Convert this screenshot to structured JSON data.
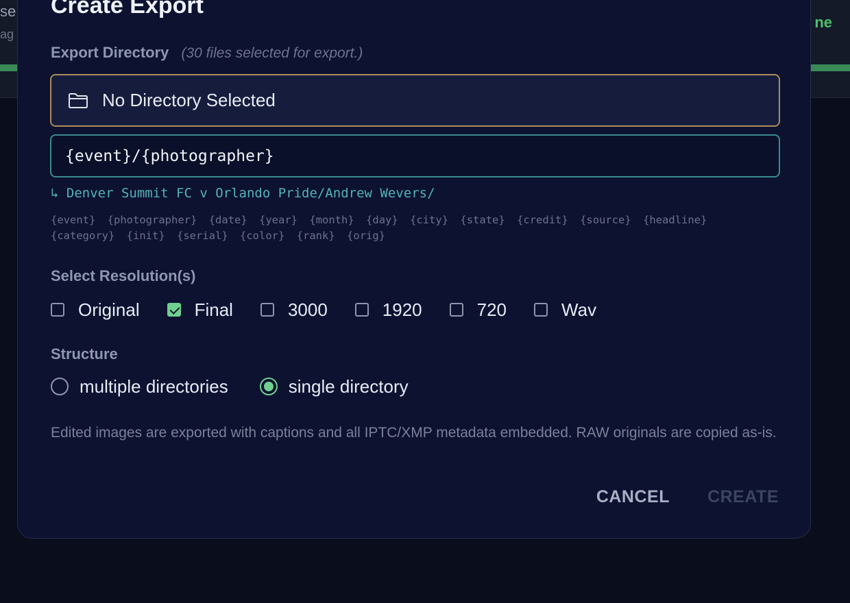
{
  "background": {
    "fragment_1": "se",
    "fragment_2": "ag",
    "fragment_3": "ne"
  },
  "dialog": {
    "title": "Create Export",
    "export_directory": {
      "label": "Export Directory",
      "hint": "(30 files selected for export.)",
      "button_label": "No Directory Selected",
      "button_icon": "folder-icon"
    },
    "path_pattern": {
      "value": "{event}/{photographer}",
      "preview": "↳ Denver Summit FC v Orlando Pride/Andrew Wevers/"
    },
    "tokens": [
      "{event}",
      "{photographer}",
      "{date}",
      "{year}",
      "{month}",
      "{day}",
      "{city}",
      "{state}",
      "{credit}",
      "{source}",
      "{headline}",
      "{category}",
      "{init}",
      "{serial}",
      "{color}",
      "{rank}",
      "{orig}"
    ],
    "resolutions": {
      "label": "Select Resolution(s)",
      "options": [
        {
          "label": "Original",
          "checked": false
        },
        {
          "label": "Final",
          "checked": true
        },
        {
          "label": "3000",
          "checked": false
        },
        {
          "label": "1920",
          "checked": false
        },
        {
          "label": "720",
          "checked": false
        },
        {
          "label": "Wav",
          "checked": false
        }
      ]
    },
    "structure": {
      "label": "Structure",
      "options": [
        {
          "label": "multiple directories",
          "selected": false
        },
        {
          "label": "single directory",
          "selected": true
        }
      ]
    },
    "note": "Edited images are exported with captions and all IPTC/XMP metadata embedded. RAW originals are copied as-is.",
    "buttons": {
      "cancel": "CANCEL",
      "create": "CREATE"
    }
  },
  "colors": {
    "modal_bg": "#0c1230",
    "accent_green": "#6fd08f",
    "directory_border": "#b08b5a",
    "input_border": "#3c8b8c",
    "preview_text": "#55b3b8"
  }
}
